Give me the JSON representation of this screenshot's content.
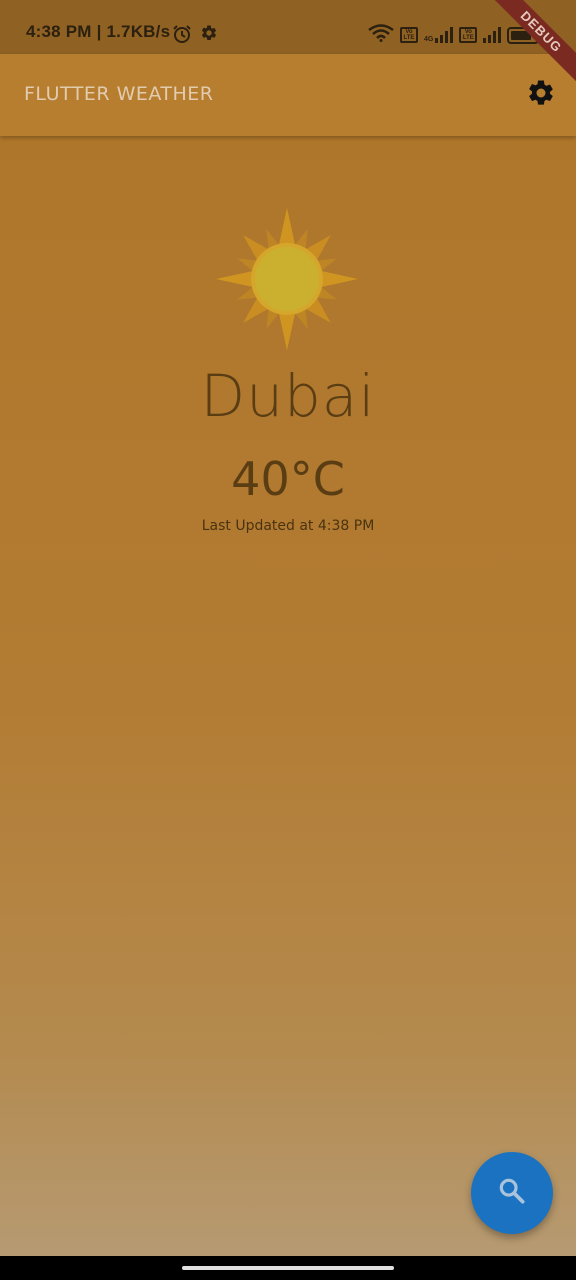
{
  "status_bar": {
    "time": "4:38 PM",
    "speed": "| 1.7KB/s",
    "icons": [
      "alarm-icon",
      "settings-icon",
      "wifi-icon",
      "volte-icon",
      "4g-signal-icon",
      "volte-icon",
      "signal-icon",
      "battery-icon"
    ],
    "badge_text": "Vo LTE",
    "network_text": "4G"
  },
  "debug_banner": "DEBUG",
  "app_bar": {
    "title": "FLUTTER WEATHER",
    "action_icon": "gear-icon"
  },
  "weather": {
    "condition_icon": "sun-icon",
    "city": "Dubai",
    "temperature": "40°C",
    "last_updated": "Last Updated at 4:38 PM"
  },
  "fab": {
    "icon": "search-icon",
    "color": "#1b72c1"
  },
  "colors": {
    "app_bar": "#b77e2f",
    "status_bar": "#8f6122",
    "text_primary": "#5a3d13"
  }
}
